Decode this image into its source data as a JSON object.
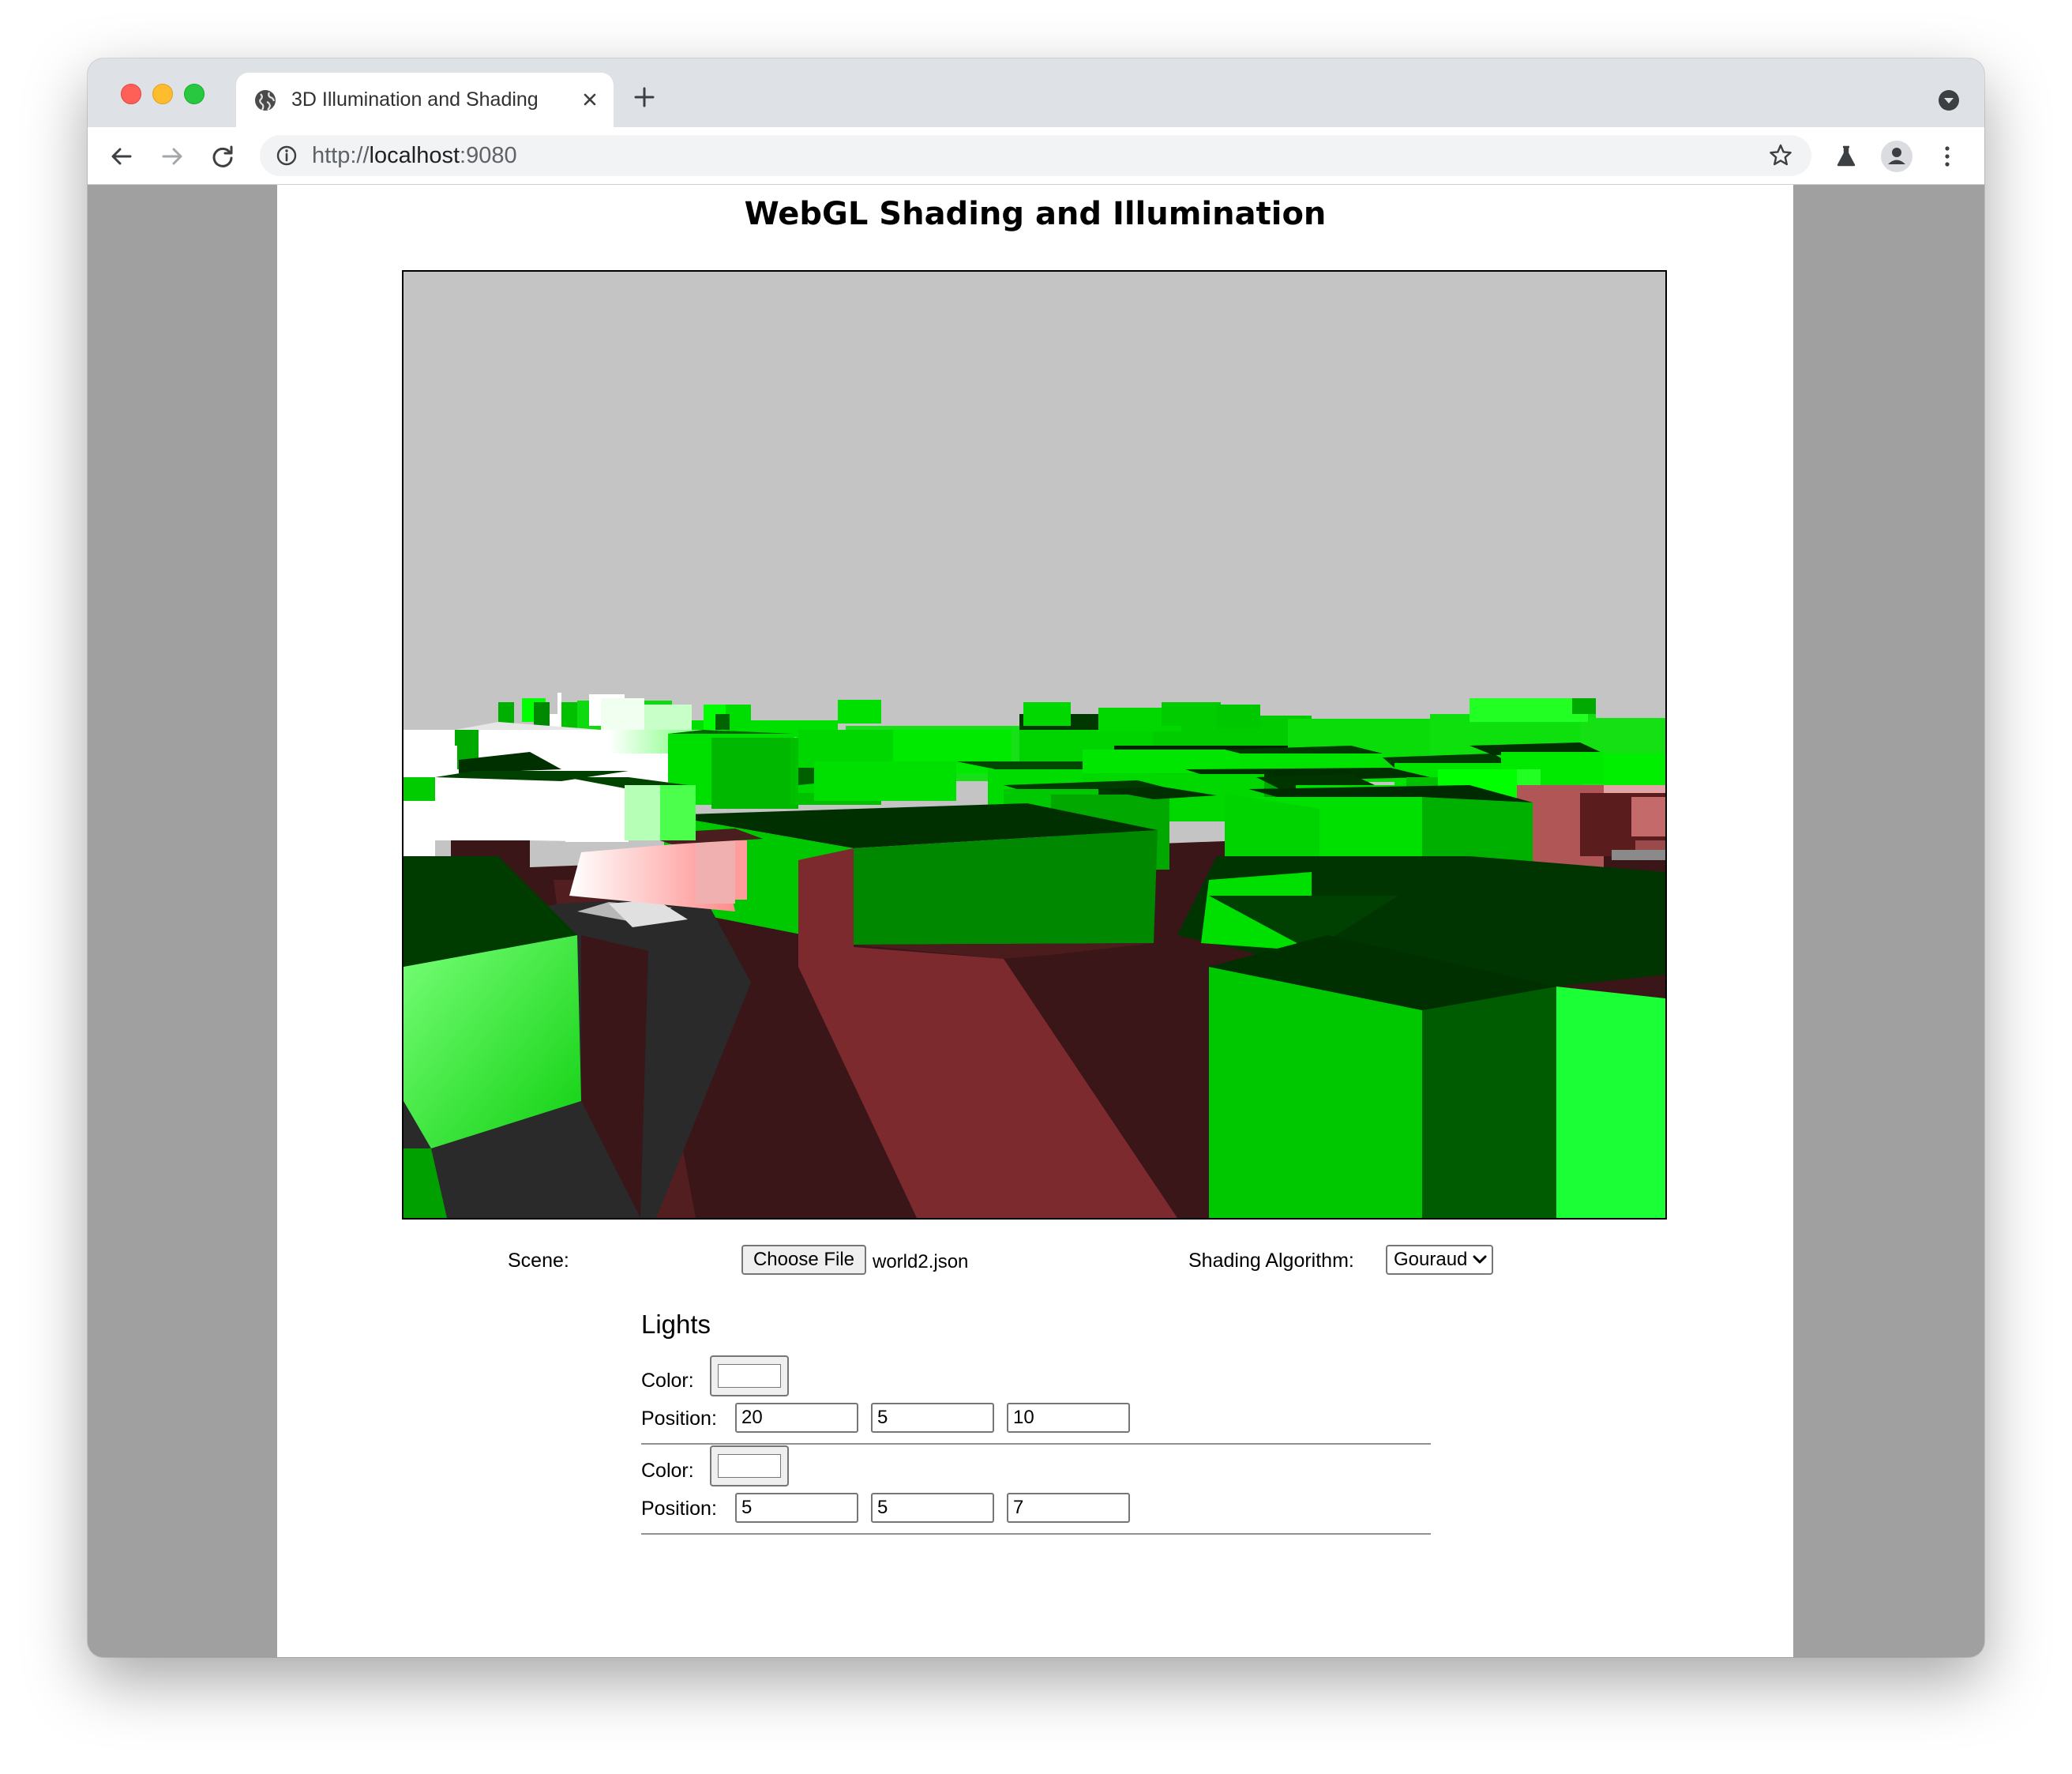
{
  "browser": {
    "tab_title": "3D Illumination and Shading",
    "url_scheme": "http://",
    "url_host": "localhost",
    "url_port": ":9080",
    "icons": [
      "globe-icon",
      "close-icon",
      "plus-icon",
      "back-icon",
      "forward-icon",
      "reload-icon",
      "info-icon",
      "star-icon",
      "labs-icon",
      "profile-icon",
      "menu-icon",
      "tab-search-icon"
    ]
  },
  "page": {
    "title": "WebGL Shading and Illumination",
    "scene_label": "Scene:",
    "choose_file_label": "Choose File",
    "file_name": "world2.json",
    "shading_label": "Shading Algorithm:",
    "shading_selected": "Gouraud",
    "lights_heading": "Lights",
    "color_label": "Color:",
    "position_label": "Position:",
    "lights": [
      {
        "color": "#ffffff",
        "position": [
          "20",
          "5",
          "10"
        ]
      },
      {
        "color": "#ffffff",
        "position": [
          "5",
          "5",
          "7"
        ]
      }
    ]
  },
  "canvas": {
    "sky_color": "#c4c4c4",
    "box_color": "#00c800",
    "floor_color": "#7d2a2e"
  }
}
